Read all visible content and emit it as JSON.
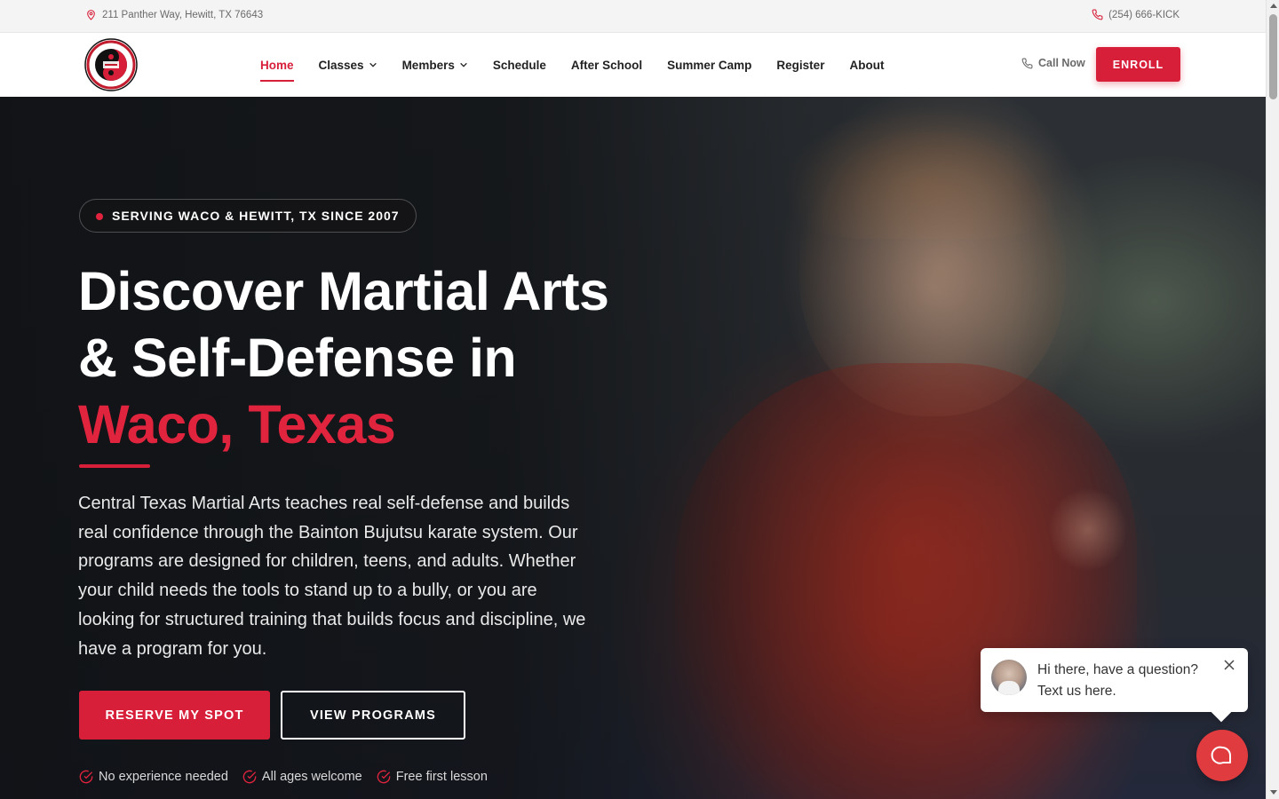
{
  "topbar": {
    "address": "211 Panther Way, Hewitt, TX 76643",
    "phone": "(254) 666-KICK",
    "address_icon": "map-pin-icon",
    "phone_icon": "phone-icon"
  },
  "header": {
    "logo_alt": "Central Texas Martial Arts Bujutsu logo",
    "nav": [
      {
        "label": "Home",
        "active": true
      },
      {
        "label": "Classes",
        "dropdown": true
      },
      {
        "label": "Members",
        "dropdown": true
      },
      {
        "label": "Schedule"
      },
      {
        "label": "After School"
      },
      {
        "label": "Summer Camp"
      },
      {
        "label": "Register"
      },
      {
        "label": "About"
      }
    ],
    "call_now": "Call Now",
    "enroll": "ENROLL"
  },
  "hero": {
    "badge": "SERVING WACO & HEWITT, TX SINCE 2007",
    "headline_line1": "Discover Martial Arts",
    "headline_line2": "& Self-Defense in",
    "headline_line3": "Waco, Texas",
    "description": "Central Texas Martial Arts teaches real self-defense and builds real confidence through the Bainton Bujutsu karate system. Our programs are designed for children, teens, and adults. Whether your child needs the tools to stand up to a bully, or you are looking for structured training that builds focus and discipline, we have a program for you.",
    "primary_button": "RESERVE MY SPOT",
    "secondary_button": "VIEW PROGRAMS",
    "checks": [
      "No experience needed",
      "All ages welcome",
      "Free first lesson"
    ]
  },
  "chat": {
    "line1": "Hi there, have a question?",
    "line2": "Text us here."
  },
  "colors": {
    "accent": "#d71f3a",
    "accent_text": "#e1243e",
    "chat_fab": "#e03b3f"
  }
}
